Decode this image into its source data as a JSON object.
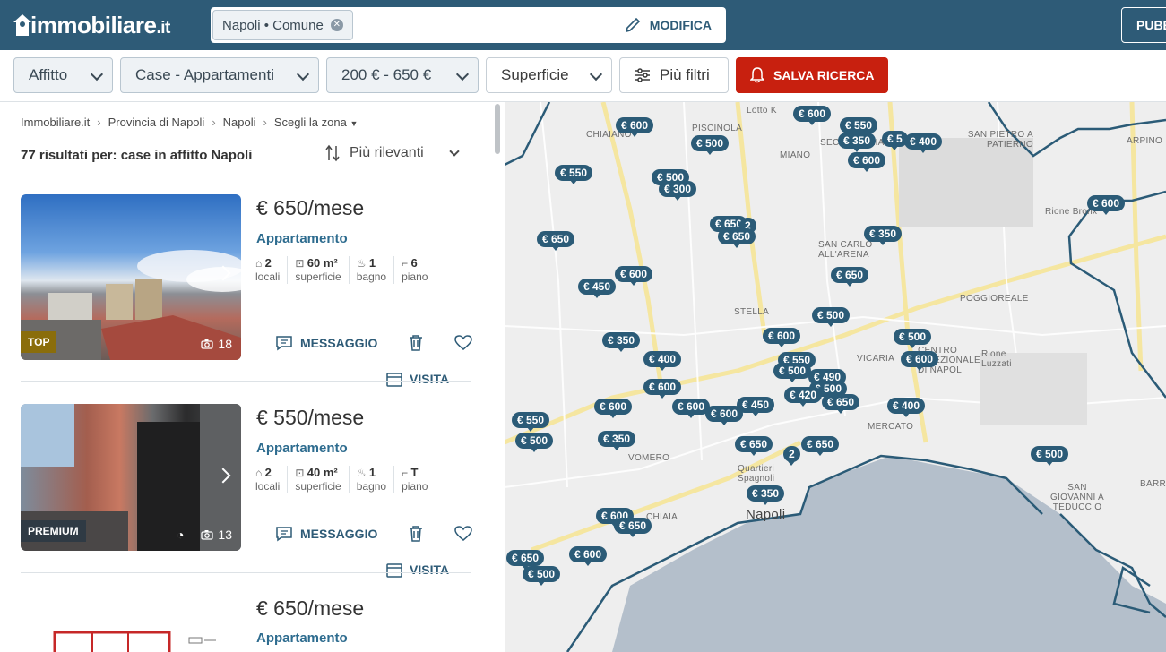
{
  "header": {
    "logo_text": "immobiliare",
    "logo_suffix": ".it",
    "search_chip": "Napoli • Comune",
    "modifica_label": "MODIFICA",
    "publish_label": "PUBB"
  },
  "filters": {
    "contract": "Affitto",
    "category": "Case - Appartamenti",
    "price": "200 € - 650 €",
    "surface": "Superficie",
    "more": "Più filtri",
    "save": "SALVA RICERCA"
  },
  "breadcrumb": [
    "Immobiliare.it",
    "Provincia di Napoli",
    "Napoli",
    "Scegli la zona"
  ],
  "results_text": "77 risultati per: case in affitto Napoli",
  "sort_label": "Più rilevanti",
  "listings": [
    {
      "price": "€ 650/mese",
      "type": "Appartamento",
      "badge": "TOP",
      "badge_color": "#8a6d0b",
      "photos": "18",
      "features": [
        {
          "value": "2",
          "unit": "",
          "label": "locali"
        },
        {
          "value": "60 m²",
          "unit": "",
          "label": "superficie"
        },
        {
          "value": "1",
          "unit": "",
          "label": "bagno"
        },
        {
          "value": "6",
          "unit": "",
          "label": "piano"
        }
      ],
      "message_label": "MESSAGGIO",
      "visit_label": "VISITA"
    },
    {
      "price": "€ 550/mese",
      "type": "Appartamento",
      "badge": "PREMIUM",
      "badge_color": "#2f3a44",
      "photos": "13",
      "features": [
        {
          "value": "2",
          "unit": "",
          "label": "locali"
        },
        {
          "value": "40 m²",
          "unit": "",
          "label": "superficie"
        },
        {
          "value": "1",
          "unit": "",
          "label": "bagno"
        },
        {
          "value": "T",
          "unit": "",
          "label": "piano"
        }
      ],
      "message_label": "MESSAGGIO",
      "visit_label": "VISITA"
    },
    {
      "price": "€ 650/mese",
      "type": "Appartamento"
    }
  ],
  "map": {
    "pins": [
      "€ 600",
      "€ 600",
      "€ 550",
      "€ 350",
      "€ 5",
      "€ 400",
      "€ 500",
      "€ 600",
      "€ 550",
      "€ 500",
      "€ 300",
      "€ 650",
      "2",
      "€ 650",
      "€ 650",
      "€ 350",
      "€ 600",
      "€ 600",
      "€ 650",
      "€ 450",
      "€ 500",
      "€ 350",
      "€ 600",
      "€ 400",
      "€ 550",
      "€ 500",
      "€ 490",
      "€ 500",
      "€ 600",
      "€ 600",
      "€ 450",
      "€ 600",
      "€ 420",
      "€ 650",
      "€ 400",
      "€ 600",
      "€ 600",
      "€ 550",
      "€ 500",
      "€ 350",
      "€ 650",
      "2",
      "€ 650",
      "€ 350",
      "€ 600",
      "€ 650",
      "€ 650",
      "€ 500",
      "€ 600",
      "€ 500",
      "€ 500"
    ],
    "places": [
      "PISCINOLA",
      "CHIAIANO",
      "MIANO",
      "SECONDIGLIANO",
      "ARPINO",
      "SAN PIETRO A PATIERNO",
      "Rione Bronx",
      "SAN CARLO ALL'ARENA",
      "STELLA",
      "POGGIOREALE",
      "VICARIA",
      "CENTRO DIREZIONALE DI NAPOLI",
      "Rione Luzzati",
      "MERCATO",
      "VOMERO",
      "Quartieri Spagnoli",
      "Napoli",
      "CHIAIA",
      "SAN GIOVANNI A TEDUCCIO",
      "BARRA",
      "Lotto K"
    ]
  }
}
